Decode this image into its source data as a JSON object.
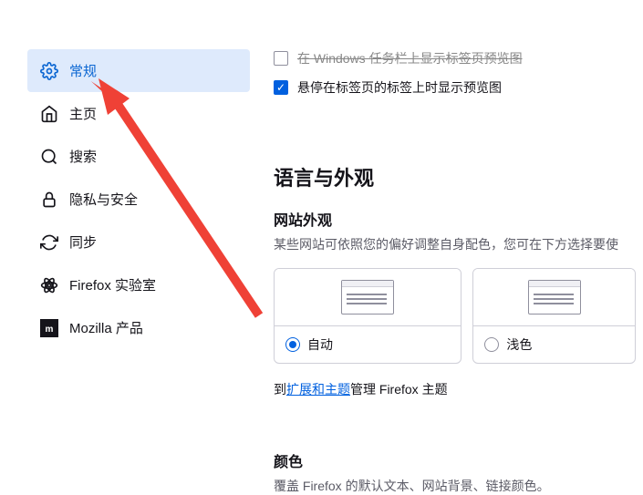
{
  "sidebar": {
    "items": [
      {
        "label": "常规"
      },
      {
        "label": "主页"
      },
      {
        "label": "搜索"
      },
      {
        "label": "隐私与安全"
      },
      {
        "label": "同步"
      },
      {
        "label": "Firefox 实验室"
      },
      {
        "label": "Mozilla 产品"
      }
    ]
  },
  "checkboxes": {
    "cb1": {
      "label": "在 Windows 任务栏上显示标签页预览图"
    },
    "cb2": {
      "label": "悬停在标签页的标签上时显示预览图"
    }
  },
  "section": {
    "title": "语言与外观",
    "appearance": {
      "title": "网站外观",
      "helper": "某些网站可依照您的偏好调整自身配色，您可在下方选择要使",
      "options": {
        "auto": "自动",
        "light": "浅色"
      }
    },
    "themeLine": {
      "prefix": "到",
      "link": "扩展和主题",
      "suffix": "管理 Firefox 主题"
    },
    "color": {
      "title": "颜色",
      "helper": "覆盖 Firefox 的默认文本、网站背景、链接颜色。"
    }
  }
}
